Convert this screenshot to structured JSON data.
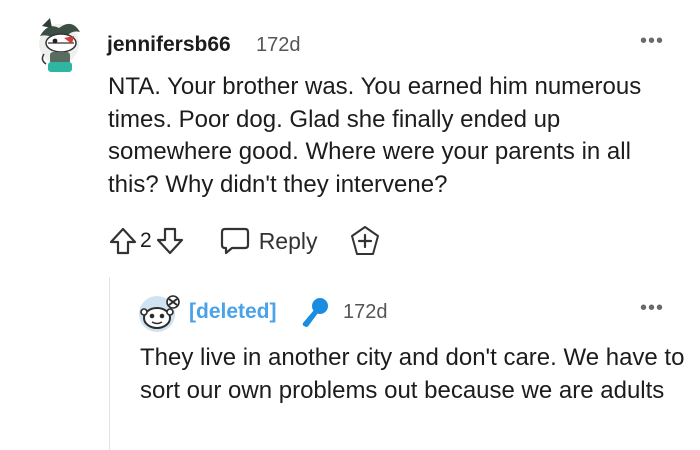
{
  "comment": {
    "username": "jennifersb66",
    "timestamp": "172d",
    "more_label": "•••",
    "body": "NTA. Your brother was. You earned him numerous times. Poor dog. Glad she finally ended up somewhere good. Where were your parents in all this? Why didn't they intervene?",
    "votes": "2",
    "reply_label": "Reply",
    "avatar_icon": "fish-avatar-icon",
    "upvote_icon": "arrow-up-icon",
    "downvote_icon": "arrow-down-icon",
    "reply_icon": "speech-bubble-icon",
    "award_icon": "award-plus-icon"
  },
  "reply": {
    "username": "[deleted]",
    "timestamp": "172d",
    "more_label": "•••",
    "body": "They live in another city and don't care. We have to sort our own problems out because we are adults",
    "avatar_icon": "snoo-avatar-icon",
    "badge_icon": "microphone-icon"
  },
  "colors": {
    "deleted_user": "#4aa3e8",
    "text": "#1c1c1c",
    "meta": "#555555",
    "thread_line": "#e3e3e3"
  }
}
